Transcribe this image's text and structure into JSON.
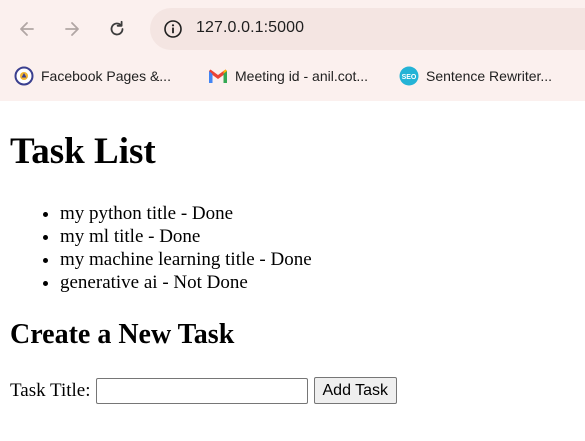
{
  "browser": {
    "url": "127.0.0.1:5000",
    "bookmarks": [
      {
        "label": "Facebook Pages &...",
        "icon": "facebook-pages-icon"
      },
      {
        "label": "Meeting id - anil.cot...",
        "icon": "gmail-icon"
      },
      {
        "label": "Sentence Rewriter...",
        "icon": "seo-icon"
      }
    ]
  },
  "page": {
    "title": "Task List",
    "tasks": [
      "my python title - Done",
      "my ml title - Done",
      "my machine learning title - Done",
      "generative ai - Not Done"
    ],
    "create_heading": "Create a New Task",
    "form": {
      "label": "Task Title:",
      "input_value": "",
      "button_label": "Add Task"
    }
  },
  "colors": {
    "chrome_background": "#fbf0ee",
    "omnibox_background": "#f4e5e2"
  }
}
